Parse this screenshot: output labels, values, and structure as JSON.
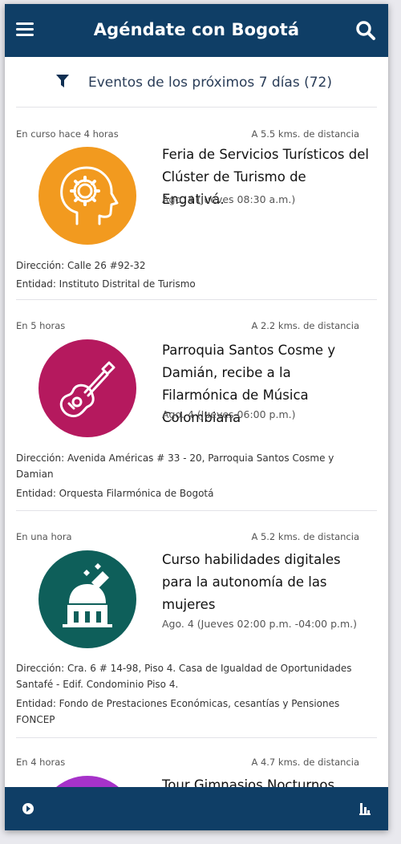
{
  "header": {
    "title": "Agéndate con Bogotá",
    "menu_icon": "menu-icon",
    "search_icon": "search-icon"
  },
  "filter": {
    "icon": "filter-icon",
    "label": "Eventos de los próximos 7 días (72)"
  },
  "events": [
    {
      "status": "En curso hace 4 horas",
      "distance": "A 5.5 kms. de distancia",
      "title": "Feria de Servicios Turísticos del Clúster de Turismo de Engativá.",
      "date": "Ago. 4 (Jueves 08:30 a.m.)",
      "address": "Dirección: Calle 26 #92-32",
      "entity": "Entidad: Instituto Distrital de Turismo",
      "icon": "head-gear-icon",
      "color": "#f29a1f"
    },
    {
      "status": "En 5 horas",
      "distance": "A 2.2 kms. de distancia",
      "title": "Parroquia Santos Cosme y Damián, recibe a la Filarmónica de Música Colombiana",
      "date": "Ago. 4 (Jueves 06:00 p.m.)",
      "address": "Dirección: Avenida Américas # 33 - 20, Parroquia Santos Cosme y Damian",
      "entity": "Entidad: Orquesta Filarmónica de Bogotá",
      "icon": "guitar-icon",
      "color": "#b5195e"
    },
    {
      "status": "En una hora",
      "distance": "A 5.2 kms. de distancia",
      "title": "Curso habilidades digitales para la autonomía de las mujeres",
      "date": "Ago. 4 (Jueves 02:00 p.m. -04:00 p.m.)",
      "address": "Dirección: Cra. 6 # 14-98, Piso 4. Casa de Igualdad de Oportunidades Santafé - Edif. Condominio Piso 4.",
      "entity": "Entidad: Fondo de Prestaciones Económicas, cesantías y Pensiones FONCEP",
      "icon": "observatory-icon",
      "color": "#0e5f5a"
    },
    {
      "status": "En 4 horas",
      "distance": "A 4.7 kms. de distancia",
      "title": "Tour Gimnasios Nocturnos",
      "color": "#a632c9"
    }
  ],
  "bottom_nav": {
    "left_icon": "location-icon",
    "right_icon": "list-icon"
  }
}
